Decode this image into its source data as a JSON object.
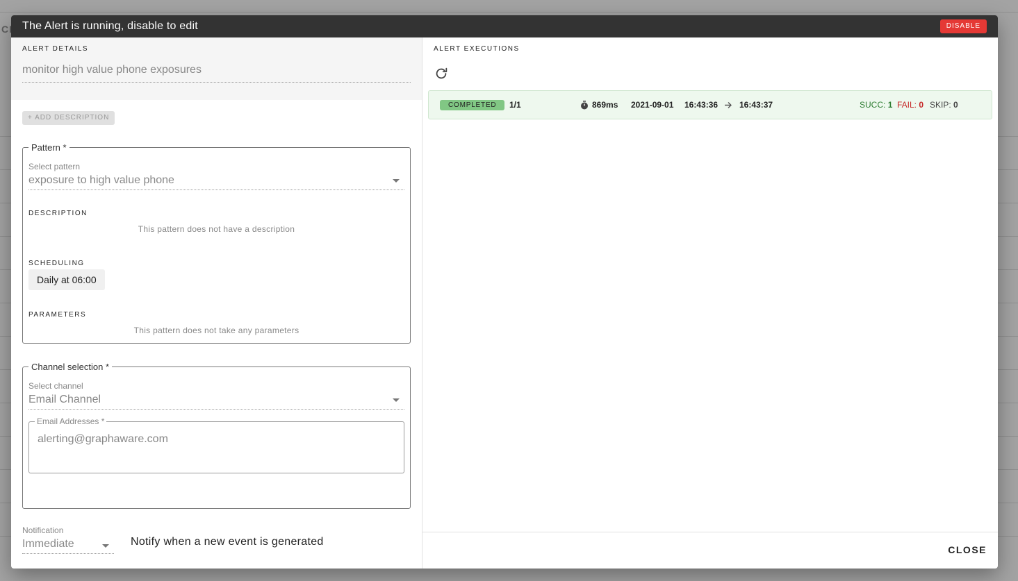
{
  "background": {
    "snippet": "CI"
  },
  "dialog": {
    "title": "The Alert is running, disable to edit",
    "disable_label": "DISABLE"
  },
  "details": {
    "section_label": "ALERT DETAILS",
    "alert_name": "monitor high value phone exposures",
    "add_description_label": "+ ADD DESCRIPTION"
  },
  "pattern": {
    "legend": "Pattern *",
    "select_label": "Select pattern",
    "selected": "exposure to high value phone",
    "description_label": "DESCRIPTION",
    "description_text": "This pattern does not have a description",
    "scheduling_label": "SCHEDULING",
    "scheduling_value": "Daily at 06:00",
    "parameters_label": "PARAMETERS",
    "parameters_text": "This pattern does not take any parameters"
  },
  "channel": {
    "legend": "Channel selection *",
    "select_label": "Select channel",
    "selected": "Email Channel",
    "email_legend": "Email Addresses *",
    "email_value": "alerting@graphaware.com"
  },
  "notification": {
    "label": "Notification",
    "selected": "Immediate",
    "description": "Notify when a new event is generated"
  },
  "executions": {
    "section_label": "ALERT EXECUTIONS",
    "rows": [
      {
        "status": "COMPLETED",
        "progress": "1/1",
        "duration": "869ms",
        "date": "2021-09-01",
        "start_time": "16:43:36",
        "end_time": "16:43:37",
        "succ_label": "SUCC:",
        "succ": "1",
        "fail_label": "FAIL:",
        "fail": "0",
        "skip_label": "SKIP:",
        "skip": "0"
      }
    ]
  },
  "footer": {
    "close_label": "CLOSE"
  },
  "colors": {
    "title_bar": "#333333",
    "disable": "#e53935",
    "success_row": "#eef8ee",
    "completed_badge": "#81c784",
    "succ": "#2e7d32",
    "fail": "#c62828"
  }
}
